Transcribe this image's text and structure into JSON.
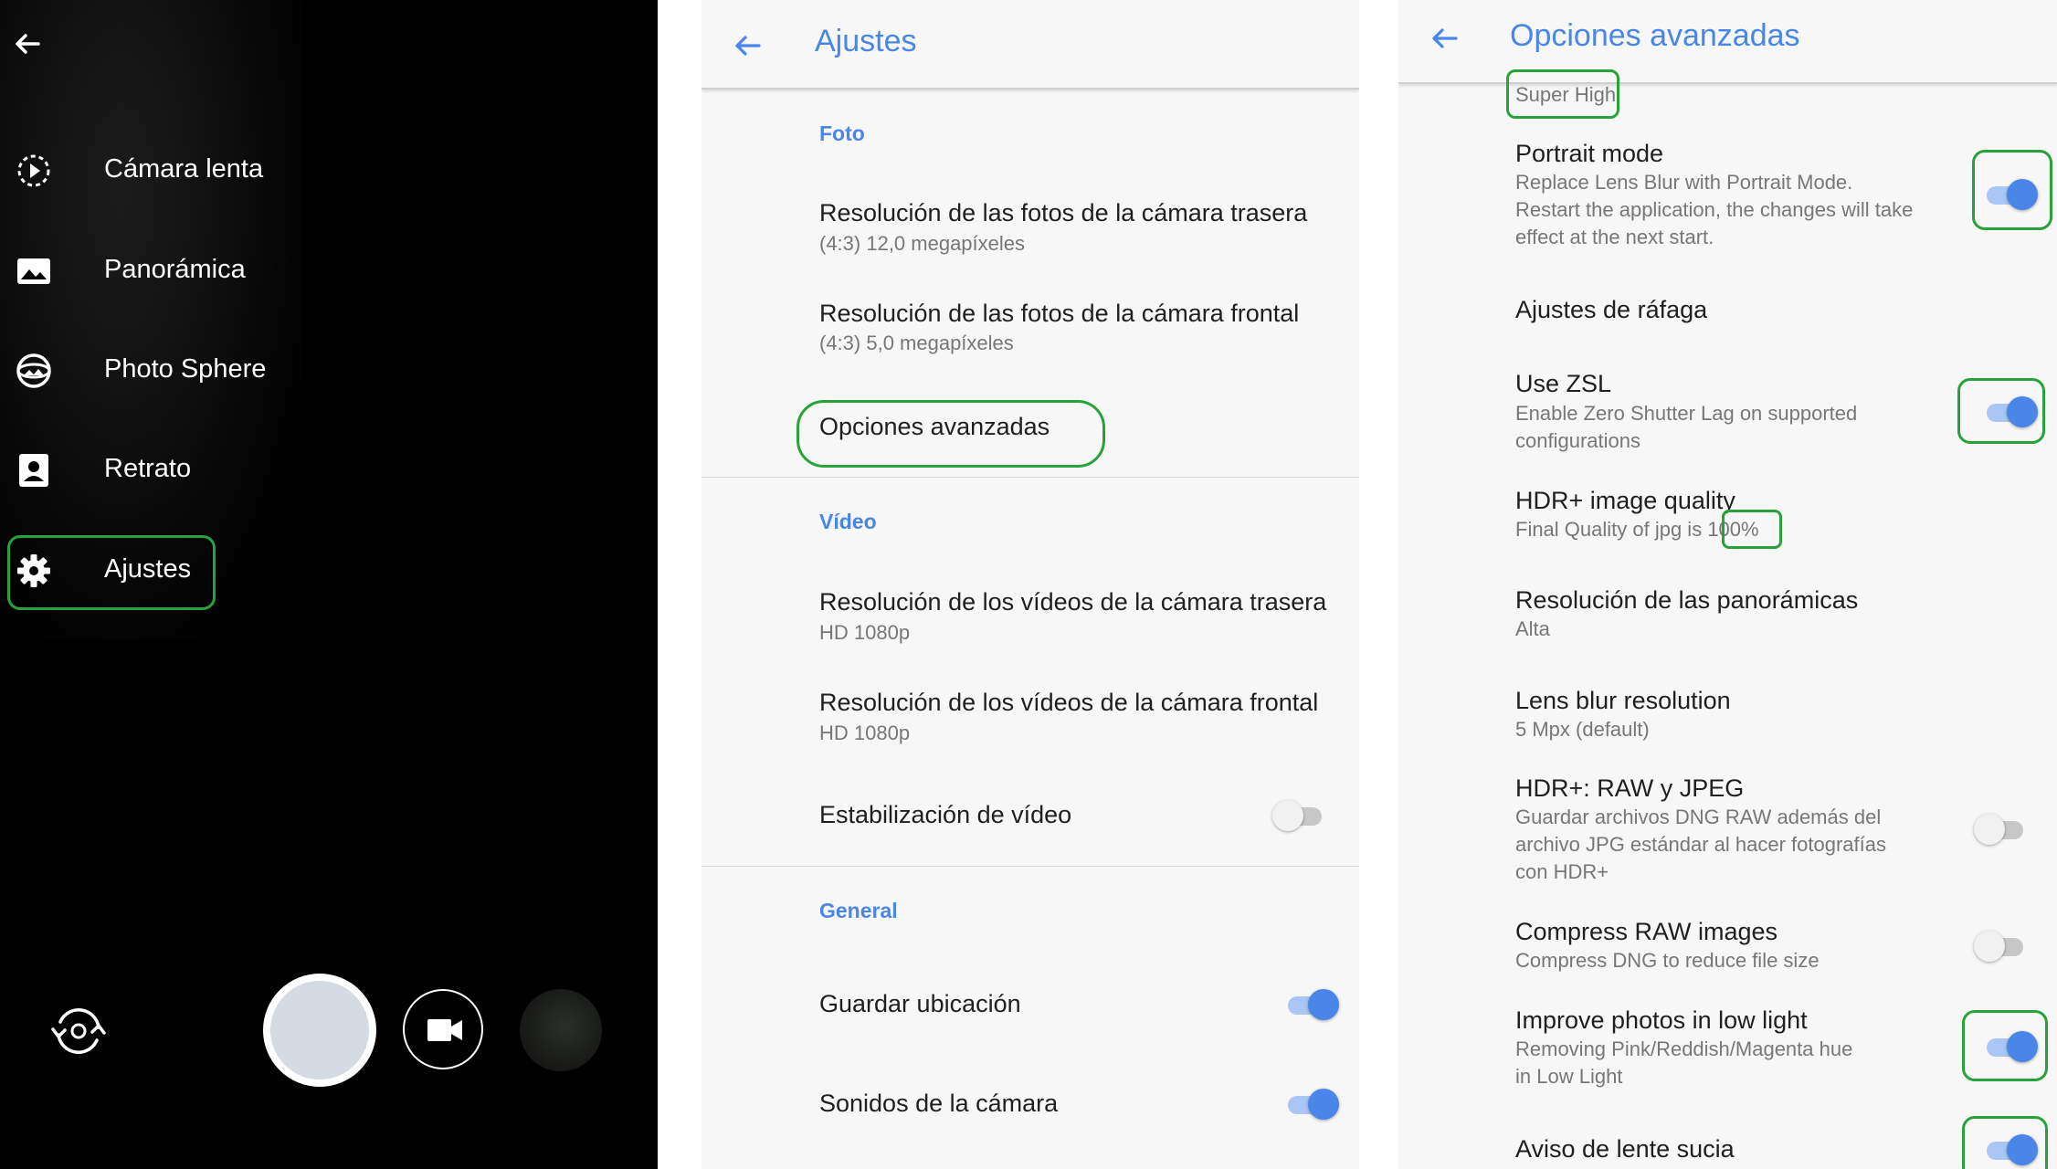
{
  "camera_menu": {
    "items": [
      {
        "label": "Cámara lenta",
        "icon": "slow-motion-icon"
      },
      {
        "label": "Panorámica",
        "icon": "panorama-icon"
      },
      {
        "label": "Photo Sphere",
        "icon": "photo-sphere-icon"
      },
      {
        "label": "Retrato",
        "icon": "portrait-icon"
      },
      {
        "label": "Ajustes",
        "icon": "gear-icon"
      }
    ],
    "bottom": {
      "switch_icon": "switch-camera-icon",
      "shutter_icon": "shutter-icon",
      "video_icon": "video-camera-icon",
      "gallery_icon": "gallery-thumbnail"
    }
  },
  "settings": {
    "title": "Ajustes",
    "foto_header": "Foto",
    "rear_photo_title": "Resolución de las fotos de la cámara trasera",
    "rear_photo_value": "(4:3) 12,0 megapíxeles",
    "front_photo_title": "Resolución de las fotos de la cámara frontal",
    "front_photo_value": "(4:3) 5,0 megapíxeles",
    "advanced": "Opciones avanzadas",
    "video_header": "Vídeo",
    "rear_video_title": "Resolución de los vídeos de la cámara trasera",
    "rear_video_value": "HD 1080p",
    "front_video_title": "Resolución de los vídeos de la cámara frontal",
    "front_video_value": "HD 1080p",
    "stabilization": "Estabilización de vídeo",
    "stabilization_on": false,
    "general_header": "General",
    "save_location": "Guardar ubicación",
    "save_location_on": true,
    "camera_sounds": "Sonidos de la cámara",
    "camera_sounds_on": true
  },
  "advanced": {
    "title": "Opciones avanzadas",
    "top_value": "Super High",
    "portrait_title": "Portrait mode",
    "portrait_desc_1": "Replace Lens Blur with Portrait Mode.",
    "portrait_desc_2": "Restart the application, the changes will take",
    "portrait_desc_3": "effect at the next start.",
    "portrait_on": true,
    "burst_title": "Ajustes de ráfaga",
    "zsl_title": "Use ZSL",
    "zsl_desc_1": "Enable Zero Shutter Lag on supported",
    "zsl_desc_2": "configurations",
    "zsl_on": true,
    "hdr_quality_title": "HDR+ image quality",
    "hdr_quality_prefix": "Final Quality of jpg is ",
    "hdr_quality_value": "100%",
    "pano_res_title": "Resolución de las panorámicas",
    "pano_res_value": "Alta",
    "lens_blur_title": "Lens blur resolution",
    "lens_blur_value": "5 Mpx (default)",
    "raw_title": "HDR+: RAW y JPEG",
    "raw_desc_1": "Guardar archivos DNG RAW además del",
    "raw_desc_2": "archivo JPG estándar al hacer fotografías",
    "raw_desc_3": "con HDR+",
    "raw_on": false,
    "compress_title": "Compress RAW images",
    "compress_desc": "Compress DNG to reduce file size",
    "compress_on": false,
    "lowlight_title": "Improve photos in low light",
    "lowlight_desc_1": "Removing Pink/Reddish/Magenta hue",
    "lowlight_desc_2": "in Low Light",
    "lowlight_on": true,
    "dirty_lens_title": "Aviso de lente sucia",
    "dirty_lens_on": true
  },
  "colors": {
    "accent": "#4a86e8",
    "highlight": "#27a33a",
    "panel_bg": "#f7f7f7"
  }
}
